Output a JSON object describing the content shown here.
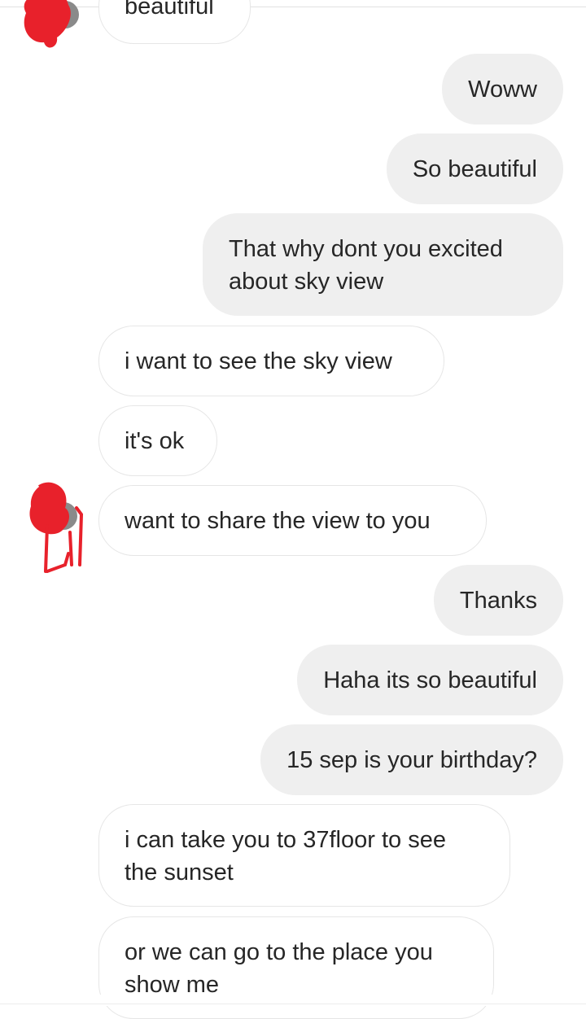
{
  "colors": {
    "incoming_bg": "#ffffff",
    "incoming_border": "#e6e6e6",
    "outgoing_bg": "#efefef",
    "text": "#262626",
    "redaction": "#e8212b"
  },
  "messages": [
    {
      "direction": "in",
      "text": "beautiful"
    },
    {
      "direction": "out",
      "text": "Woww"
    },
    {
      "direction": "out",
      "text": "So beautiful"
    },
    {
      "direction": "out",
      "text": "That why dont you excited about sky view"
    },
    {
      "direction": "in",
      "text": "i want to see the sky view"
    },
    {
      "direction": "in",
      "text": "it's ok"
    },
    {
      "direction": "in",
      "text": "want to share the view to you"
    },
    {
      "direction": "out",
      "text": "Thanks"
    },
    {
      "direction": "out",
      "text": "Haha its so beautiful"
    },
    {
      "direction": "out",
      "text": "15 sep is your birthday?"
    },
    {
      "direction": "in",
      "text": "i can take you to 37floor to see the sunset"
    },
    {
      "direction": "in",
      "text": "or we can go to the place you show me"
    }
  ]
}
